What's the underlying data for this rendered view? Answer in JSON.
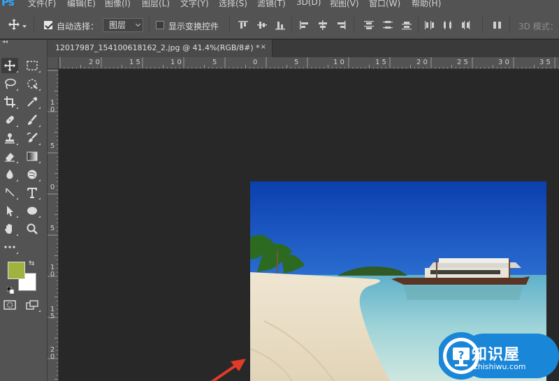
{
  "app": {
    "logo": "Ps"
  },
  "menu": {
    "items": [
      "文件(F)",
      "编辑(E)",
      "图像(I)",
      "图层(L)",
      "文字(Y)",
      "选择(S)",
      "滤镜(T)",
      "3D(D)",
      "视图(V)",
      "窗口(W)",
      "帮助(H)"
    ]
  },
  "options": {
    "auto_select_label": "自动选择：",
    "auto_select_checked": true,
    "layer_select_value": "图层",
    "show_transform_label": "显示变换控件",
    "show_transform_checked": false,
    "mode_3d_label": "3D 模式："
  },
  "document": {
    "tab_title": "12017987_154100618162_2.jpg @ 41.4%(RGB/8#) *",
    "close_glyph": "×"
  },
  "ruler": {
    "top_labels": [
      "2 0",
      "1 5",
      "1 0",
      "5",
      "0",
      "5",
      "1 0",
      "1 5",
      "2 0",
      "2 5",
      "3 0",
      "3 5"
    ],
    "left_labels": [
      "1 0",
      "5",
      "0",
      "5",
      "1 0",
      "1 5",
      "2 0"
    ]
  },
  "colors": {
    "foreground": "#9fb43f",
    "background": "#ffffff",
    "accent": "#31a8ff",
    "arrow": "#e23a2a"
  },
  "tools": [
    "move-tool-icon",
    "marquee-tool-icon",
    "lasso-tool-icon",
    "quick-select-tool-icon",
    "crop-tool-icon",
    "eyedropper-tool-icon",
    "healing-brush-tool-icon",
    "brush-tool-icon",
    "clone-stamp-tool-icon",
    "history-brush-tool-icon",
    "eraser-tool-icon",
    "gradient-tool-icon",
    "blur-tool-icon",
    "dodge-tool-icon",
    "pen-tool-icon",
    "type-tool-icon",
    "path-select-tool-icon",
    "ellipse-tool-icon",
    "hand-tool-icon",
    "zoom-tool-icon",
    "more-tools-icon",
    "quick-mask-icon",
    "screen-mode-icon"
  ],
  "watermark": {
    "title": "知识屋",
    "url": "zhishiwu.com"
  }
}
